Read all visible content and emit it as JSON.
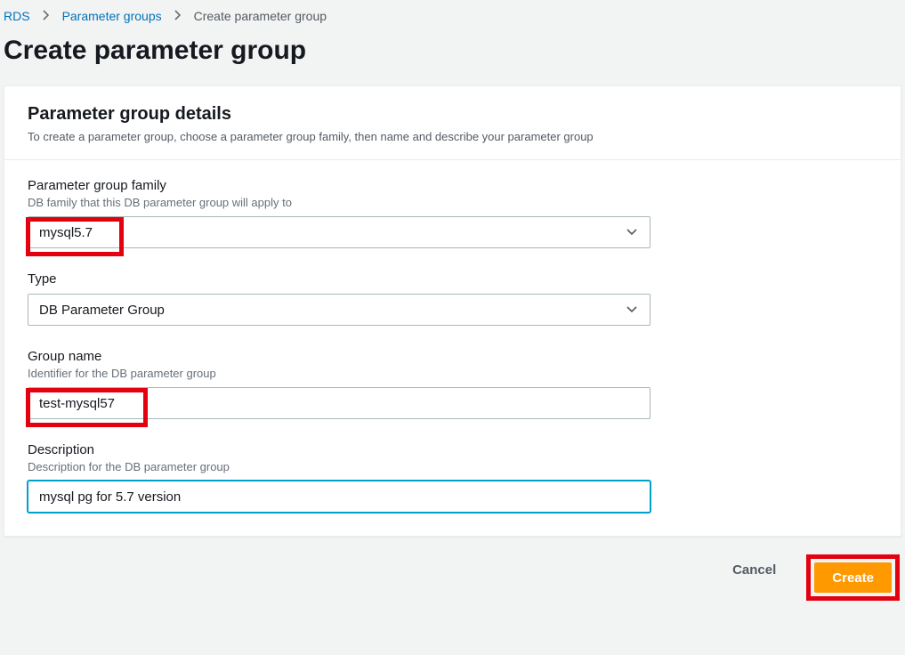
{
  "breadcrumb": {
    "item1": "RDS",
    "item2": "Parameter groups",
    "item3": "Create parameter group"
  },
  "page_title": "Create parameter group",
  "panel": {
    "title": "Parameter group details",
    "desc": "To create a parameter group, choose a parameter group family, then name and describe your parameter group"
  },
  "fields": {
    "family": {
      "label": "Parameter group family",
      "help": "DB family that this DB parameter group will apply to",
      "value": "mysql5.7"
    },
    "type": {
      "label": "Type",
      "value": "DB Parameter Group"
    },
    "group_name": {
      "label": "Group name",
      "help": "Identifier for the DB parameter group",
      "value": "test-mysql57"
    },
    "description": {
      "label": "Description",
      "help": "Description for the DB parameter group",
      "value": "mysql pg for 5.7 version"
    }
  },
  "actions": {
    "cancel": "Cancel",
    "create": "Create"
  }
}
